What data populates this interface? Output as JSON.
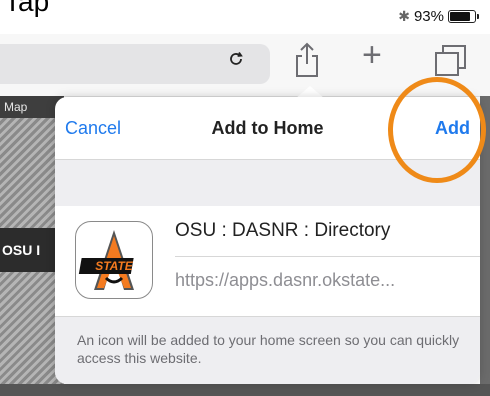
{
  "top_text": "Tap",
  "status": {
    "battery_label": "93%",
    "battery_fill": 0.93,
    "bluetooth_icon": "bluetooth-icon"
  },
  "toolbar": {
    "reload_icon": "reload-icon",
    "share_icon": "share-icon",
    "new_tab_icon": "plus-icon",
    "tabs_icon": "tabs-icon"
  },
  "background": {
    "map_label": "Map",
    "osu_label": "OSU I"
  },
  "dialog": {
    "cancel_label": "Cancel",
    "title": "Add to Home",
    "add_label": "Add",
    "site_name": "OSU : DASNR : Directory",
    "site_url": "https://apps.dasnr.okstate...",
    "app_icon_text": "STATE",
    "footer_text": "An icon will be added to your home screen so you can quickly access this website."
  },
  "colors": {
    "accent": "#1f7aed",
    "highlight": "#ef8a18",
    "osu_orange": "#f47b20"
  }
}
